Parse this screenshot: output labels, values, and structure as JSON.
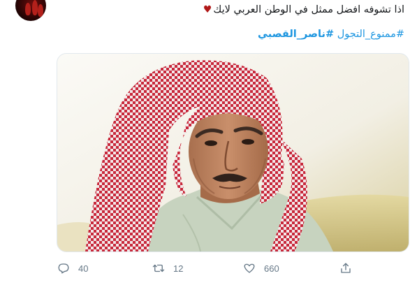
{
  "tweet": {
    "text": "اذا تشوفه افضل ممثل في الوطن العربي لايك",
    "heart_emoji": "♥",
    "hashtags": [
      {
        "text": "#ممنوع_التجول",
        "bold": false
      },
      {
        "text": "#ناصر_القصبي",
        "bold": true
      }
    ],
    "media": {
      "description_icon": "photo"
    },
    "actions": {
      "reply": {
        "icon": "reply-icon",
        "count": "40"
      },
      "retweet": {
        "icon": "retweet-icon",
        "count": "12"
      },
      "like": {
        "icon": "heart-icon",
        "count": "660"
      },
      "share": {
        "icon": "share-icon"
      }
    }
  },
  "colors": {
    "text": "#14171a",
    "link": "#1b95e0",
    "muted": "#657786",
    "border": "#e1e8ed",
    "emoji_heart": "#b01818"
  }
}
